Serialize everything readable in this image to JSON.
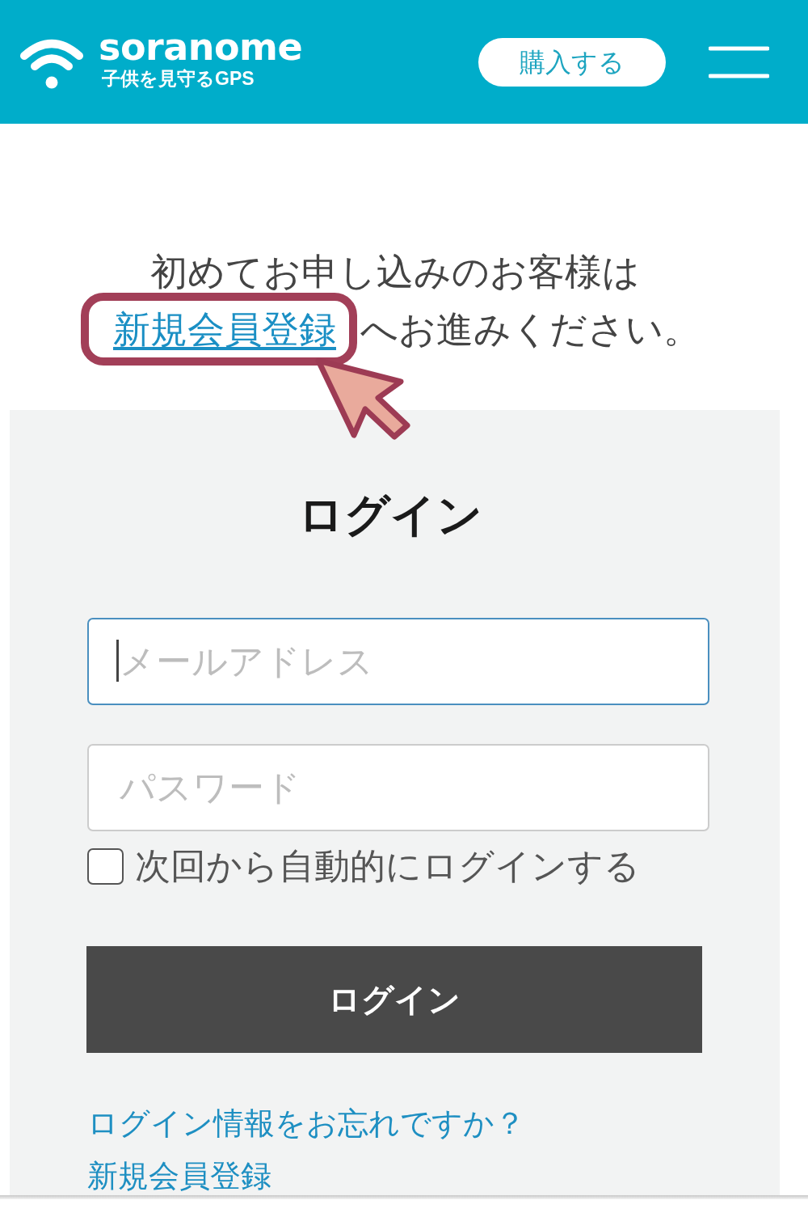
{
  "header": {
    "brand": {
      "name": "soranome",
      "tagline": "子供を見守るGPS"
    },
    "buy_button": "購入する"
  },
  "intro": {
    "text_before": "初めてお申し込みのお客様は",
    "link": "新規会員登録",
    "text_after": "へお進みください。"
  },
  "login": {
    "title": "ログイン",
    "fields": [
      {
        "placeholder": "メールアドレス",
        "focused": true
      },
      {
        "placeholder": "パスワード",
        "focused": false
      }
    ],
    "remember": {
      "label": "次回から自動的にログインする",
      "checked": false
    },
    "submit": "ログイン",
    "links": [
      "ログイン情報をお忘れですか？",
      "新規会員登録"
    ]
  }
}
